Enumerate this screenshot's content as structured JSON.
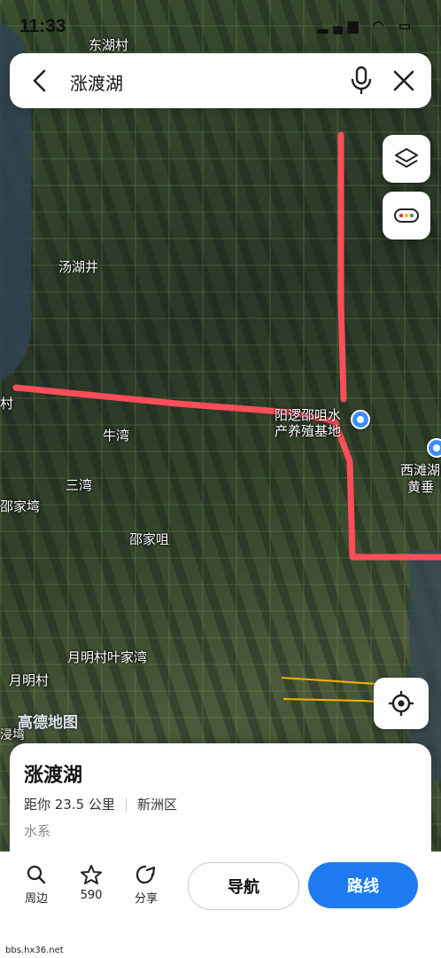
{
  "status_bar": {
    "time": "11:33",
    "system": "▂▄▆ ◠ ▭"
  },
  "search": {
    "query": "涨渡湖"
  },
  "map": {
    "places": [
      {
        "id": "donghu",
        "label": "东湖村"
      },
      {
        "id": "tanghujing",
        "label": "汤湖井"
      },
      {
        "id": "cun",
        "label": "村"
      },
      {
        "id": "niuwan",
        "label": "牛湾"
      },
      {
        "id": "sanwan",
        "label": "三湾"
      },
      {
        "id": "shaojiawan",
        "label": "邵家塆"
      },
      {
        "id": "shaojiaju",
        "label": "邵家咀"
      },
      {
        "id": "yuemingcun_yejia",
        "label": "月明村叶家湾"
      },
      {
        "id": "yuemingcun",
        "label": "月明村"
      },
      {
        "id": "xiyou",
        "label": "浸塆"
      },
      {
        "id": "yangluo",
        "label": "阳逻邵咀水"
      },
      {
        "id": "chanyang",
        "label": "产养殖基地"
      },
      {
        "id": "xitan",
        "label": "西滩湖"
      },
      {
        "id": "huangjiao",
        "label": "黄垂"
      }
    ],
    "brand": "高德地图",
    "route_color": "#ff4d5a"
  },
  "place": {
    "name": "涨渡湖",
    "distance": "距你 23.5 公里",
    "district": "新洲区",
    "category": "水系"
  },
  "actions": {
    "nearby": "周边",
    "favorite_count": "590",
    "share": "分享",
    "navigate": "导航",
    "route": "路线"
  },
  "watermark": "bbs.hx36.net",
  "colors": {
    "accent": "#1f7cf0"
  }
}
